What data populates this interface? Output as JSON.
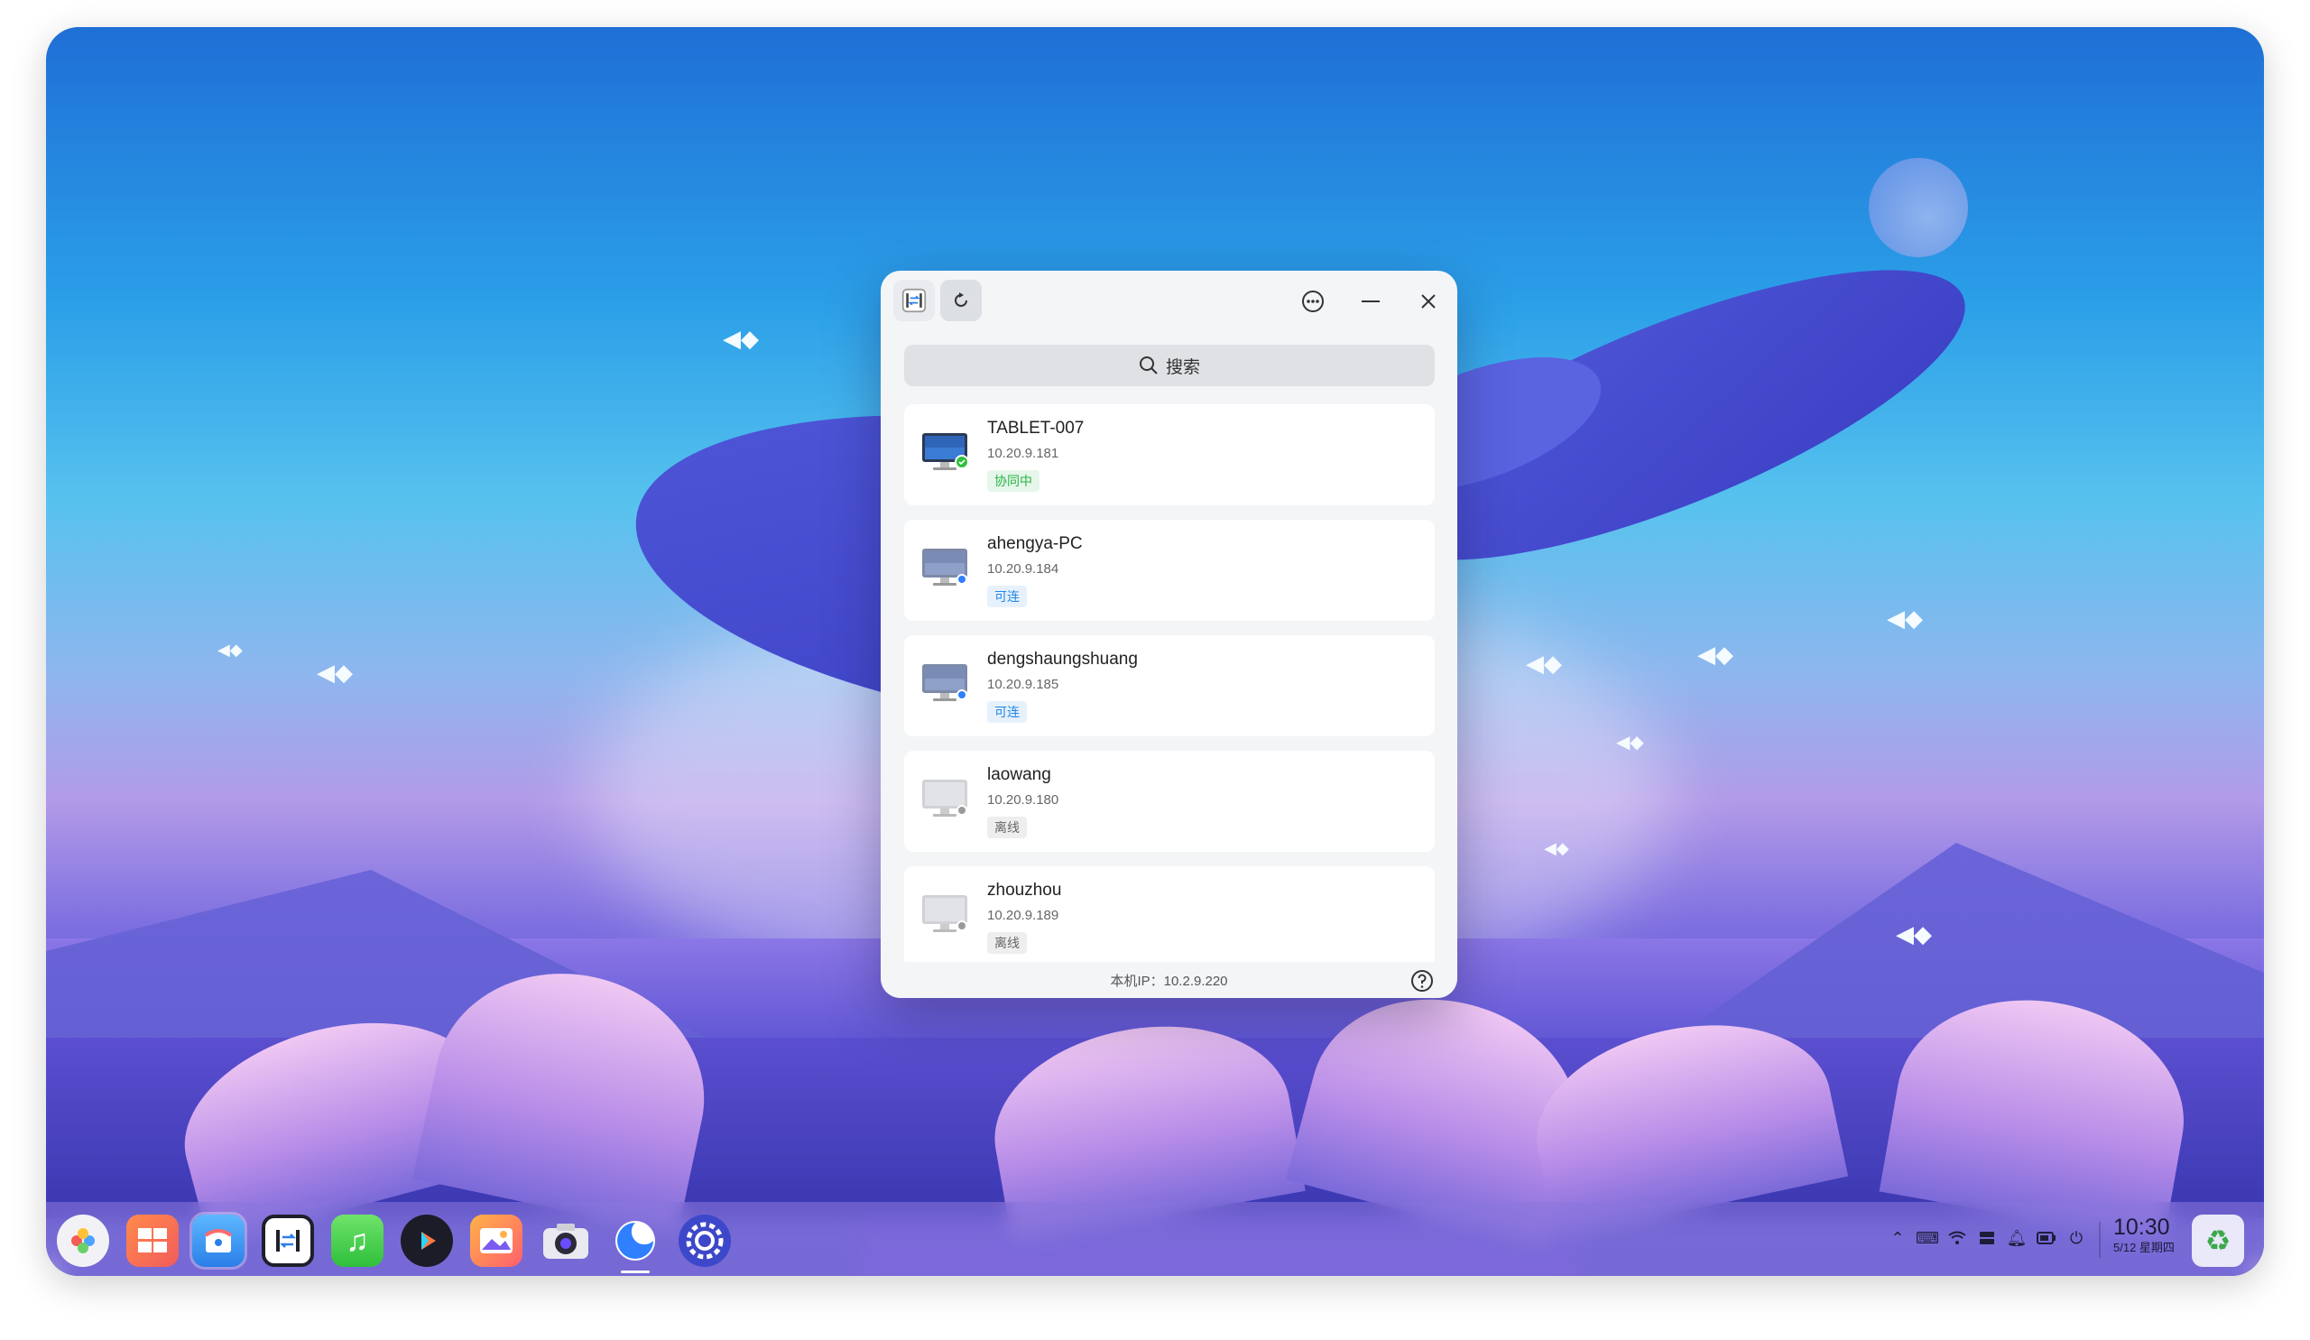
{
  "window": {
    "search_placeholder": "搜索",
    "local_ip_label": "本机IP：10.2.9.220",
    "devices": [
      {
        "name": "TABLET-007",
        "ip": "10.20.9.181",
        "status": "协同中",
        "status_color": "#28b446",
        "status_bg": "#e6f6ea",
        "icon_state": "connected"
      },
      {
        "name": "ahengya-PC",
        "ip": "10.20.9.184",
        "status": "可连",
        "status_color": "#1e88e5",
        "status_bg": "#e6f1fc",
        "icon_state": "available"
      },
      {
        "name": "dengshaungshuang",
        "ip": "10.20.9.185",
        "status": "可连",
        "status_color": "#1e88e5",
        "status_bg": "#e6f1fc",
        "icon_state": "available"
      },
      {
        "name": "laowang",
        "ip": "10.20.9.180",
        "status": "离线",
        "status_color": "#666666",
        "status_bg": "#eeeeee",
        "icon_state": "offline"
      },
      {
        "name": "zhouzhou",
        "ip": "10.20.9.189",
        "status": "离线",
        "status_color": "#666666",
        "status_bg": "#eeeeee",
        "icon_state": "offline"
      }
    ]
  },
  "taskbar": {
    "time": "10:30",
    "date": "5/12 星期四",
    "apps": [
      "launcher-icon",
      "multitask-icon",
      "app-store-icon",
      "collaboration-icon",
      "music-icon",
      "video-player-icon",
      "image-viewer-icon",
      "camera-icon",
      "browser-icon",
      "settings-icon"
    ],
    "tray": [
      "chevron-up-icon",
      "keyboard-icon",
      "wifi-icon",
      "storage-icon",
      "bell-icon",
      "battery-icon",
      "power-icon"
    ]
  }
}
